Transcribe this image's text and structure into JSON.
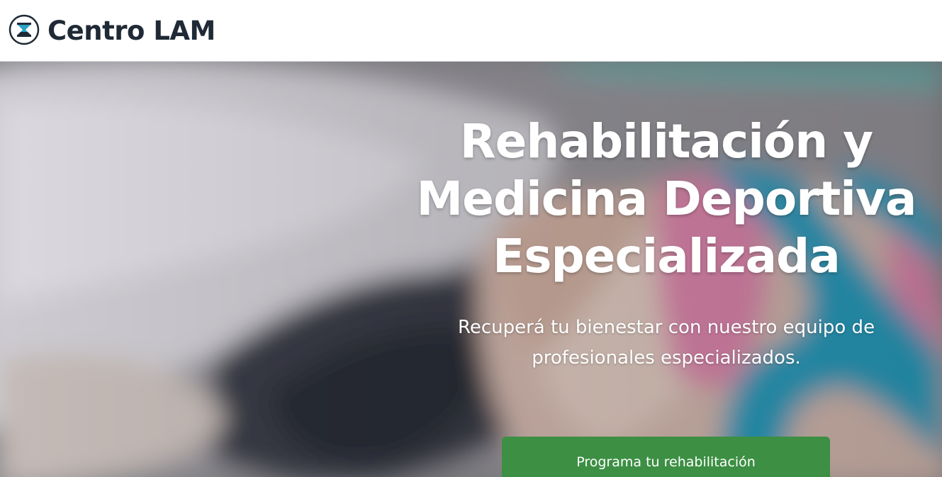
{
  "header": {
    "brand": "Centro LAM",
    "logo_icon": "hourglass-logo-icon"
  },
  "hero": {
    "title_lines": [
      "Rehabilitación y",
      "Medicina Deportiva",
      "Especializada"
    ],
    "subtitle_lines": [
      "Recuperá tu bienestar con nuestro equipo de",
      "profesionales especializados."
    ],
    "cta_label": "Programa tu rehabilitación",
    "background_image": "physiotherapy-kinesio-tape-knee-photo"
  },
  "colors": {
    "brand_text": "#1f2a36",
    "cta_green": "#3c8f43",
    "tape_blue": "#2aa3c4",
    "tape_pink": "#e58bb3"
  }
}
